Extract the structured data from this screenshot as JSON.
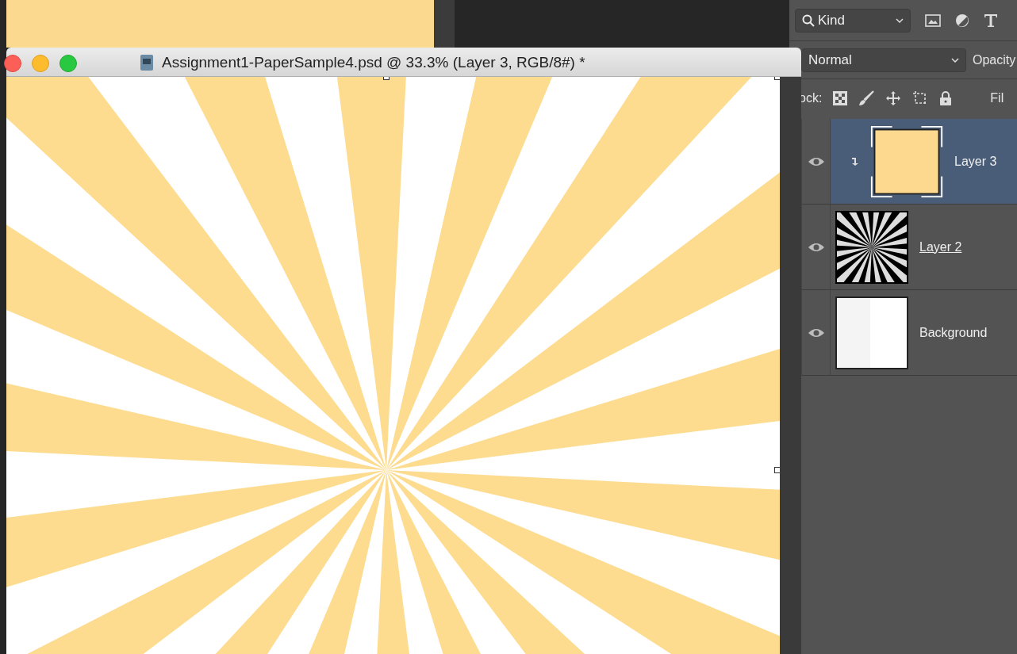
{
  "document": {
    "title": "Assignment1-PaperSample4.psd @ 33.3% (Layer 3, RGB/8#) *"
  },
  "layers_panel": {
    "filter": {
      "value": "Kind"
    },
    "blend_mode": {
      "value": "Normal"
    },
    "opacity_label": "Opacity",
    "lock_label": "ock:",
    "fill_label": "Fil",
    "layers": [
      {
        "name": "Layer 3",
        "selected": true,
        "visible": true,
        "clipped": true,
        "underlined": false,
        "kind": "fill"
      },
      {
        "name": "Layer 2",
        "selected": false,
        "visible": true,
        "clipped": false,
        "underlined": true,
        "kind": "sunburst"
      },
      {
        "name": "Background",
        "selected": false,
        "visible": true,
        "clipped": false,
        "underlined": false,
        "kind": "white"
      }
    ]
  }
}
